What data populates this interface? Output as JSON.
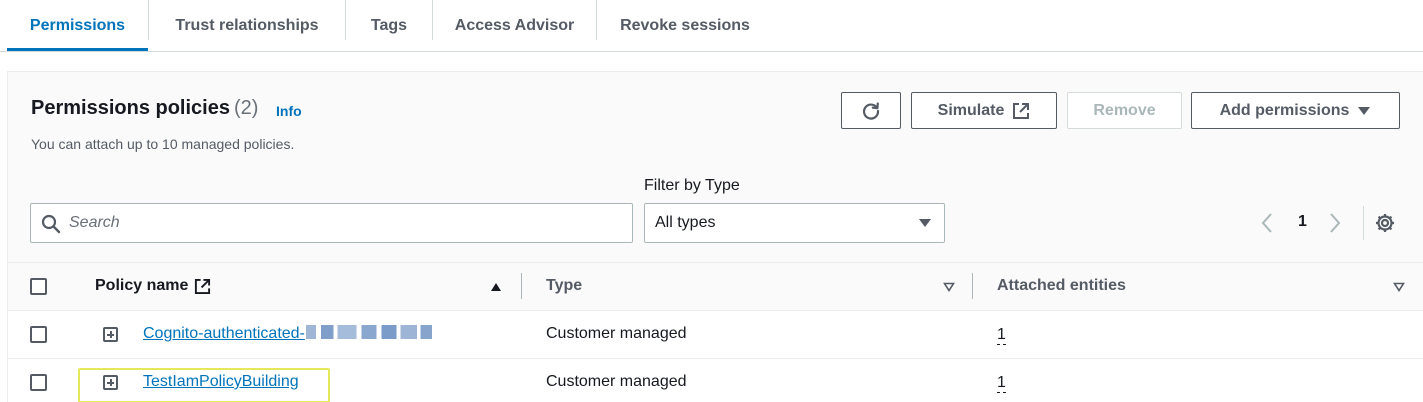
{
  "tabs": [
    {
      "label": "Permissions",
      "active": true
    },
    {
      "label": "Trust relationships",
      "active": false
    },
    {
      "label": "Tags",
      "active": false
    },
    {
      "label": "Access Advisor",
      "active": false
    },
    {
      "label": "Revoke sessions",
      "active": false
    }
  ],
  "header": {
    "title": "Permissions policies",
    "count": "(2)",
    "info": "Info",
    "subtitle": "You can attach up to 10 managed policies."
  },
  "actions": {
    "refresh_icon": "refresh-icon",
    "simulate": "Simulate",
    "simulate_icon": "external-link-icon",
    "remove": "Remove",
    "add_permissions": "Add permissions"
  },
  "filter": {
    "search_placeholder": "Search",
    "type_label": "Filter by Type",
    "type_value": "All types"
  },
  "pagination": {
    "current_page": "1"
  },
  "table": {
    "columns": {
      "policy_name": "Policy name",
      "type": "Type",
      "attached_entities": "Attached entities"
    },
    "rows": [
      {
        "policy_name": "Cognito-authenticated-",
        "policy_name_redacted": true,
        "type": "Customer managed",
        "attached_entities": "1"
      },
      {
        "policy_name": "TestIamPolicyBuilding",
        "policy_name_redacted": false,
        "type": "Customer managed",
        "attached_entities": "1",
        "highlighted": true
      }
    ]
  },
  "colors": {
    "accent": "#0073bb",
    "highlight": "#e6e85c",
    "text": "#16191f",
    "muted": "#545b64"
  }
}
